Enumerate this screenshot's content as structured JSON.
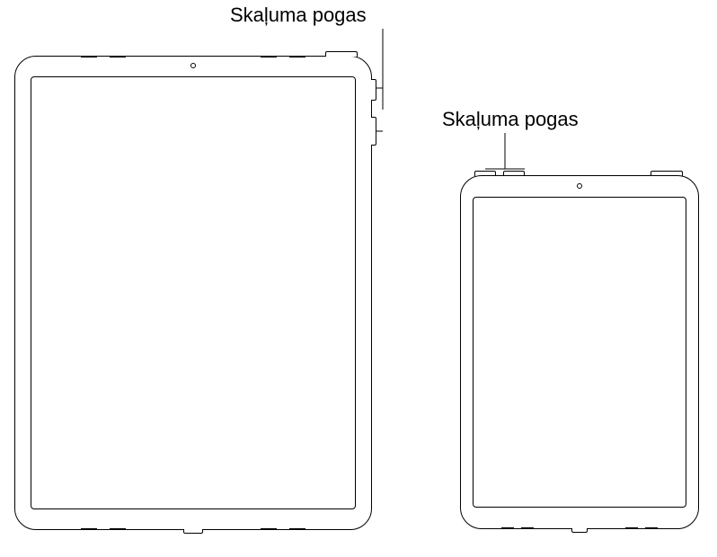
{
  "labels": {
    "left": "Skaļuma pogas",
    "right": "Skaļuma pogas"
  }
}
